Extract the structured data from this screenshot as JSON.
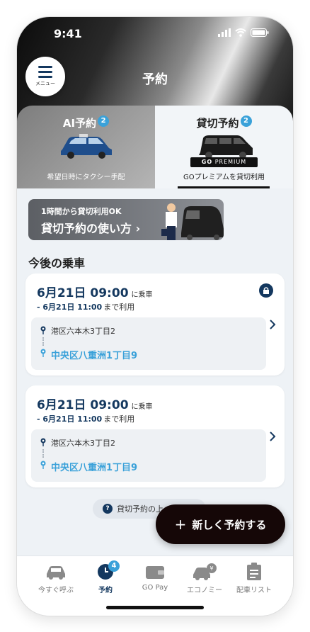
{
  "status": {
    "time": "9:41"
  },
  "header": {
    "title": "予約",
    "menu_label": "メニュー"
  },
  "tabs": [
    {
      "label": "AI予約",
      "badge": "2",
      "subtitle": "希望日時にタクシー手配"
    },
    {
      "label": "貸切予約",
      "badge": "2",
      "brand": "PREMIUM",
      "subtitle": "GOプレミアムを貸切利用"
    }
  ],
  "banner": {
    "line1": "1時間から貸切利用OK",
    "line2": "貸切予約の使い方 ›"
  },
  "section_title": "今後の乗車",
  "reservations": [
    {
      "date_time": "6月21日 09:00",
      "pickup_suffix": "に乗車",
      "end_time": "- 6月21日 11:00",
      "end_suffix": "まで利用",
      "from": "港区六本木3丁目2",
      "to": "中央区八重洲1丁目9"
    },
    {
      "date_time": "6月21日 09:00",
      "pickup_suffix": "に乗車",
      "end_time": "- 6月21日 11:00",
      "end_suffix": "まで利用",
      "from": "港区六本木3丁目2",
      "to": "中央区八重洲1丁目9"
    }
  ],
  "help_text": "貸切予約の上",
  "fab_label": "新しく予約する",
  "nav": [
    {
      "label": "今すぐ呼ぶ"
    },
    {
      "label": "予約",
      "badge": "4"
    },
    {
      "label": "GO Pay"
    },
    {
      "label": "エコノミー"
    },
    {
      "label": "配車リスト"
    }
  ],
  "colors": {
    "navy": "#14385f",
    "accent": "#3aa1d9",
    "fab": "#150707"
  }
}
